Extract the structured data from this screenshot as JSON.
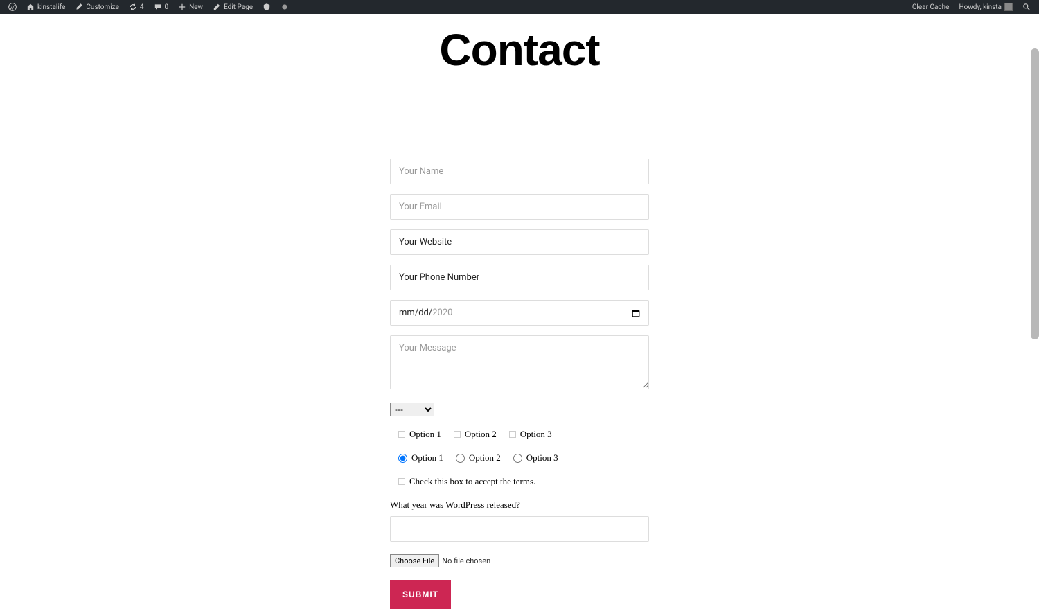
{
  "adminbar": {
    "site_name": "kinstalife",
    "customize": "Customize",
    "updates_count": "4",
    "comments_count": "0",
    "new_label": "New",
    "edit_page": "Edit Page",
    "clear_cache": "Clear Cache",
    "howdy": "Howdy, kinsta"
  },
  "page": {
    "title": "Contact"
  },
  "form": {
    "name_placeholder": "Your Name",
    "email_placeholder": "Your Email",
    "website_placeholder": "Your Website",
    "phone_placeholder": "Your Phone Number",
    "date_mm": "mm",
    "date_dd": "dd",
    "date_yy": "2020",
    "message_placeholder": "Your Message",
    "select_default": "---",
    "checkbox_options": [
      "Option 1",
      "Option 2",
      "Option 3"
    ],
    "radio_options": [
      "Option 1",
      "Option 2",
      "Option 3"
    ],
    "accept_label": "Check this box to accept the terms.",
    "quiz_question": "What year was WordPress released?",
    "file_button": "Choose File",
    "file_status": "No file chosen",
    "submit": "SUBMIT"
  }
}
